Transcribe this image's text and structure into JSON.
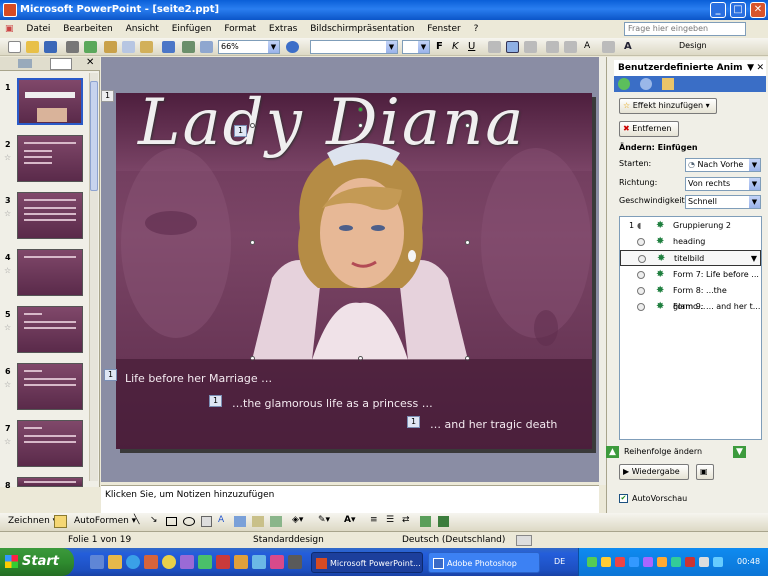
{
  "window": {
    "title": "Microsoft PowerPoint - [seite2.ppt]"
  },
  "menu": [
    "Datei",
    "Bearbeiten",
    "Ansicht",
    "Einfügen",
    "Format",
    "Extras",
    "Bildschirmpräsentation",
    "Fenster",
    "?"
  ],
  "help_placeholder": "Frage hier eingeben",
  "toolbar": {
    "zoom": "66%",
    "design_label": "Design"
  },
  "slides": {
    "numbers": [
      "1",
      "2",
      "3",
      "4",
      "5",
      "6",
      "7",
      "8"
    ],
    "selected": "1"
  },
  "slide": {
    "title": "Lady Diana",
    "line1": "Life before her Marriage …",
    "line2": "…the glamorous life as a princess …",
    "line3": "… and her tragic death",
    "marker": "1"
  },
  "notes_placeholder": "Klicken Sie, um Notizen hinzuzufügen",
  "taskpane": {
    "title": "Benutzerdefinierte Animation",
    "add_effect": "Effekt hinzufügen",
    "remove": "Entfernen",
    "change_label": "Ändern: Einfügen",
    "start_label": "Starten:",
    "start_value": "Nach Vorhe",
    "direction_label": "Richtung:",
    "direction_value": "Von rechts",
    "speed_label": "Geschwindigkeit:",
    "speed_value": "Schnell",
    "items": [
      {
        "num": "1",
        "label": "Gruppierung 2"
      },
      {
        "num": "",
        "label": "heading"
      },
      {
        "num": "",
        "label": "titelbild"
      },
      {
        "num": "",
        "label": "Form 7: Life before ..."
      },
      {
        "num": "",
        "label": "Form 8: ...the glamo..."
      },
      {
        "num": "",
        "label": "Form 9: ... and her t..."
      }
    ],
    "reorder": "Reihenfolge ändern",
    "play": "Wiedergabe",
    "autopreview": "AutoVorschau"
  },
  "drawbar": {
    "draw": "Zeichnen",
    "autoshapes": "AutoFormen"
  },
  "status": {
    "slide": "Folie 1 von 19",
    "design": "Standarddesign",
    "language": "Deutsch (Deutschland)"
  },
  "taskbar": {
    "start": "Start",
    "item1": "Microsoft PowerPoint...",
    "item2": "Adobe Photoshop",
    "lang": "DE",
    "clock": "00:48"
  }
}
